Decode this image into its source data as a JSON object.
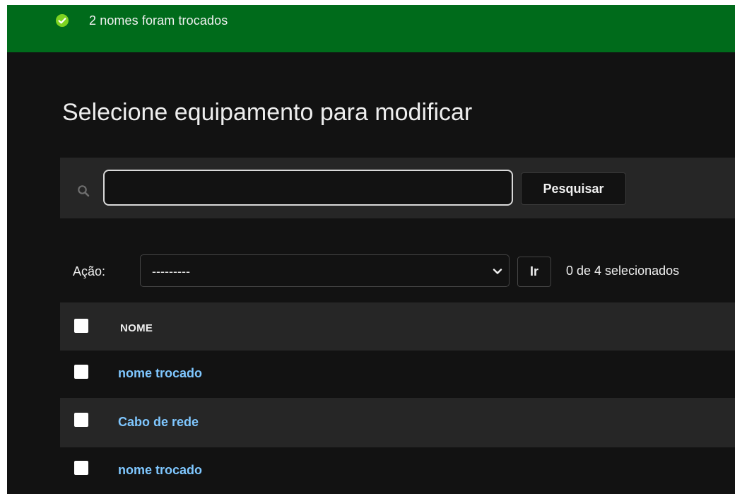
{
  "message": {
    "text": "2 nomes foram trocados",
    "icon": "check-circle-icon",
    "background": "#006b1b"
  },
  "page": {
    "title": "Selecione equipamento para modificar"
  },
  "search": {
    "icon": "search-icon",
    "value": "",
    "button_label": "Pesquisar"
  },
  "actions": {
    "label": "Ação:",
    "selected": "---------",
    "go_label": "Ir",
    "counter": "0 de 4 selecionados"
  },
  "table": {
    "column_header": "NOME",
    "rows": [
      {
        "name": "nome trocado"
      },
      {
        "name": "Cabo de rede"
      },
      {
        "name": "nome trocado"
      }
    ]
  },
  "colors": {
    "link": "#7fc7ff",
    "background": "#121212",
    "panel": "#262626"
  }
}
